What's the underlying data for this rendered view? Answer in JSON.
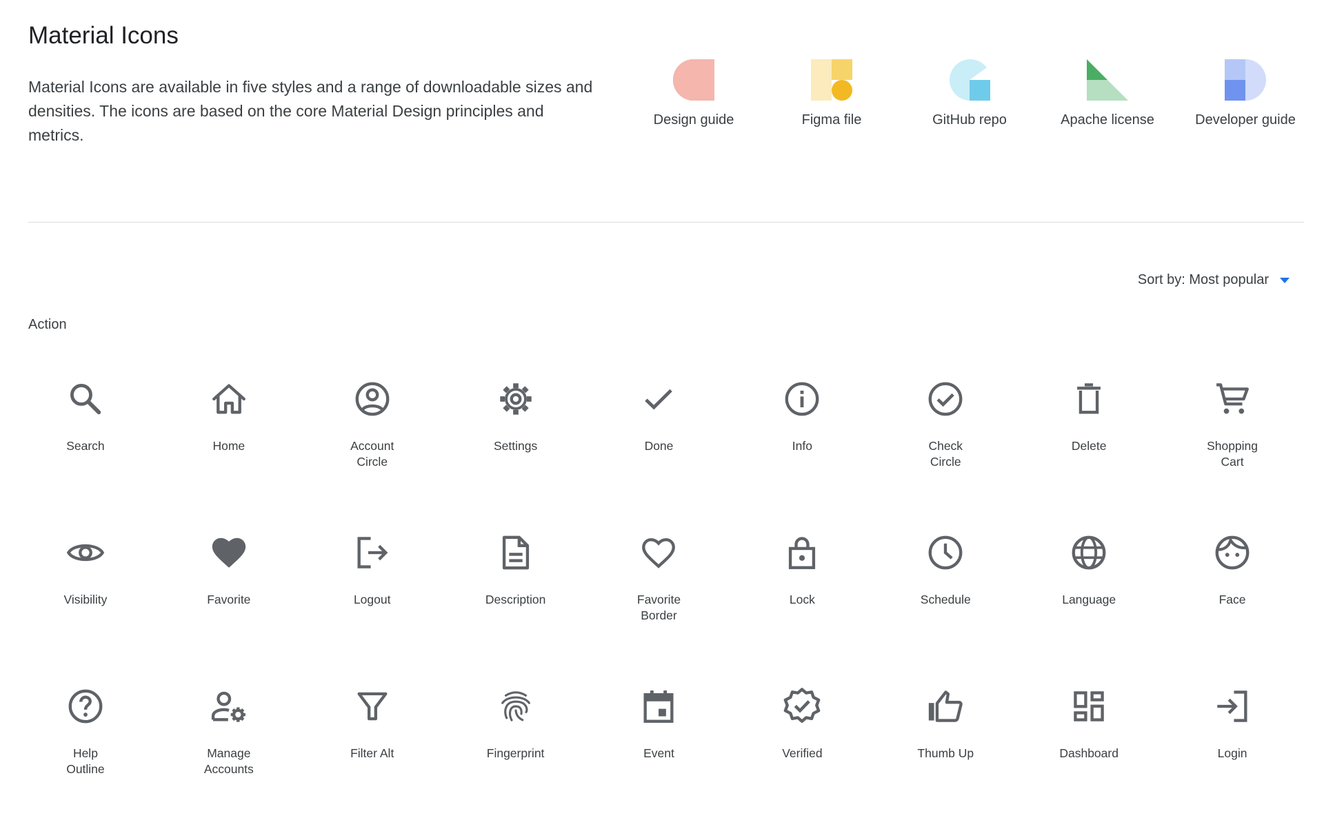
{
  "header": {
    "title": "Material Icons",
    "description": "Material Icons are available in five styles and a range of downloadable sizes and densities. The icons are based on the core Material Design principles and metrics."
  },
  "resources": [
    {
      "label": "Design guide",
      "icon": "design-guide-icon"
    },
    {
      "label": "Figma file",
      "icon": "figma-file-icon"
    },
    {
      "label": "GitHub repo",
      "icon": "github-repo-icon"
    },
    {
      "label": "Apache license",
      "icon": "apache-license-icon"
    },
    {
      "label": "Developer guide",
      "icon": "developer-guide-icon"
    }
  ],
  "sort": {
    "label": "Sort by: Most popular"
  },
  "section": {
    "label": "Action"
  },
  "icons": [
    {
      "label": "Search",
      "icon": "search-icon"
    },
    {
      "label": "Home",
      "icon": "home-icon"
    },
    {
      "label": "Account Circle",
      "icon": "account-circle-icon"
    },
    {
      "label": "Settings",
      "icon": "settings-icon"
    },
    {
      "label": "Done",
      "icon": "done-icon"
    },
    {
      "label": "Info",
      "icon": "info-icon"
    },
    {
      "label": "Check Circle",
      "icon": "check-circle-icon"
    },
    {
      "label": "Delete",
      "icon": "delete-icon"
    },
    {
      "label": "Shopping Cart",
      "icon": "shopping-cart-icon"
    },
    {
      "label": "Visibility",
      "icon": "visibility-icon"
    },
    {
      "label": "Favorite",
      "icon": "favorite-icon"
    },
    {
      "label": "Logout",
      "icon": "logout-icon"
    },
    {
      "label": "Description",
      "icon": "description-icon"
    },
    {
      "label": "Favorite Border",
      "icon": "favorite-border-icon"
    },
    {
      "label": "Lock",
      "icon": "lock-icon"
    },
    {
      "label": "Schedule",
      "icon": "schedule-icon"
    },
    {
      "label": "Language",
      "icon": "language-icon"
    },
    {
      "label": "Face",
      "icon": "face-icon"
    },
    {
      "label": "Help Outline",
      "icon": "help-outline-icon"
    },
    {
      "label": "Manage Accounts",
      "icon": "manage-accounts-icon"
    },
    {
      "label": "Filter Alt",
      "icon": "filter-alt-icon"
    },
    {
      "label": "Fingerprint",
      "icon": "fingerprint-icon"
    },
    {
      "label": "Event",
      "icon": "event-icon"
    },
    {
      "label": "Verified",
      "icon": "verified-icon"
    },
    {
      "label": "Thumb Up",
      "icon": "thumb-up-icon"
    },
    {
      "label": "Dashboard",
      "icon": "dashboard-icon"
    },
    {
      "label": "Login",
      "icon": "login-icon"
    }
  ],
  "colors": {
    "icon_gray": "#5f6368",
    "text": "#3c4043",
    "accent": "#1a73e8",
    "divider": "#dadce0"
  }
}
